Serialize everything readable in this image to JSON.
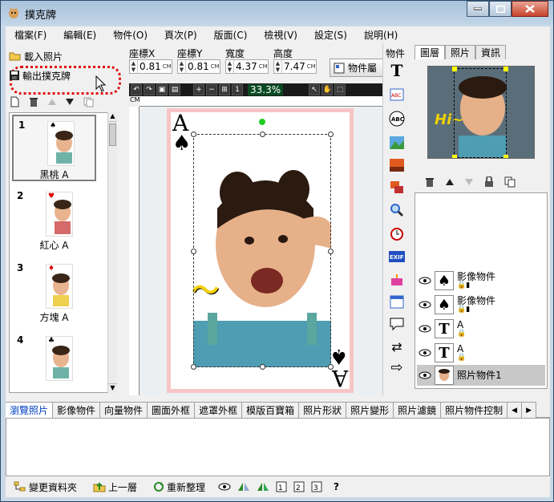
{
  "window": {
    "title": "撲克牌",
    "app_icon": "cat-app-icon"
  },
  "menu": [
    "檔案(F)",
    "編輯(E)",
    "物件(O)",
    "頁次(P)",
    "版面(C)",
    "檢視(V)",
    "設定(S)",
    "說明(H)"
  ],
  "left_panel": {
    "load_photo": "載入照片",
    "export_cards": "輸出撲克牌",
    "cards": [
      {
        "num": "1",
        "name": "黑桃 A",
        "suit": "♠",
        "selected": true
      },
      {
        "num": "2",
        "name": "紅心 A",
        "suit": "♥",
        "selected": false
      },
      {
        "num": "3",
        "name": "方塊 A",
        "suit": "♦",
        "selected": false
      },
      {
        "num": "4",
        "name": "",
        "suit": "♣",
        "selected": false
      }
    ]
  },
  "coords": {
    "x_label": "座標X",
    "x_value": "0.81",
    "y_label": "座標Y",
    "y_value": "0.81",
    "w_label": "寬度",
    "w_value": "4.37",
    "h_label": "高度",
    "h_value": "7.47",
    "unit": "CM",
    "object_button": "物件屬"
  },
  "view": {
    "zoom": "33.3%",
    "ruler_unit": "CM"
  },
  "canvas": {
    "rank": "A",
    "suit": "♠",
    "overlay_text": "〜"
  },
  "tool_column": {
    "title": "物件"
  },
  "right_panel": {
    "tabs": [
      "圖層",
      "照片",
      "資訊"
    ],
    "active_tab": 0,
    "preview_text": "Hi~",
    "layers": [
      {
        "name": "影像物件",
        "type": "image"
      },
      {
        "name": "影像物件",
        "type": "image"
      },
      {
        "name": "A",
        "type": "text"
      },
      {
        "name": "A",
        "type": "text"
      },
      {
        "name": "照片物件1",
        "type": "photo",
        "selected": true
      }
    ]
  },
  "bottom_tabs": [
    "瀏覽照片",
    "影像物件",
    "向量物件",
    "圖面外框",
    "遮罩外框",
    "模版百寶箱",
    "照片形狀",
    "照片變形",
    "照片濾鏡",
    "照片物件控制"
  ],
  "bottom_active_tab": 0,
  "bottom_status": {
    "change_folder": "變更資料夾",
    "up_level": "上一層",
    "refresh": "重新整理",
    "help": "?"
  },
  "colors": {
    "card_border": "#f7c5c5",
    "highlight": "#e01010",
    "accent_blue": "#0040c0"
  }
}
